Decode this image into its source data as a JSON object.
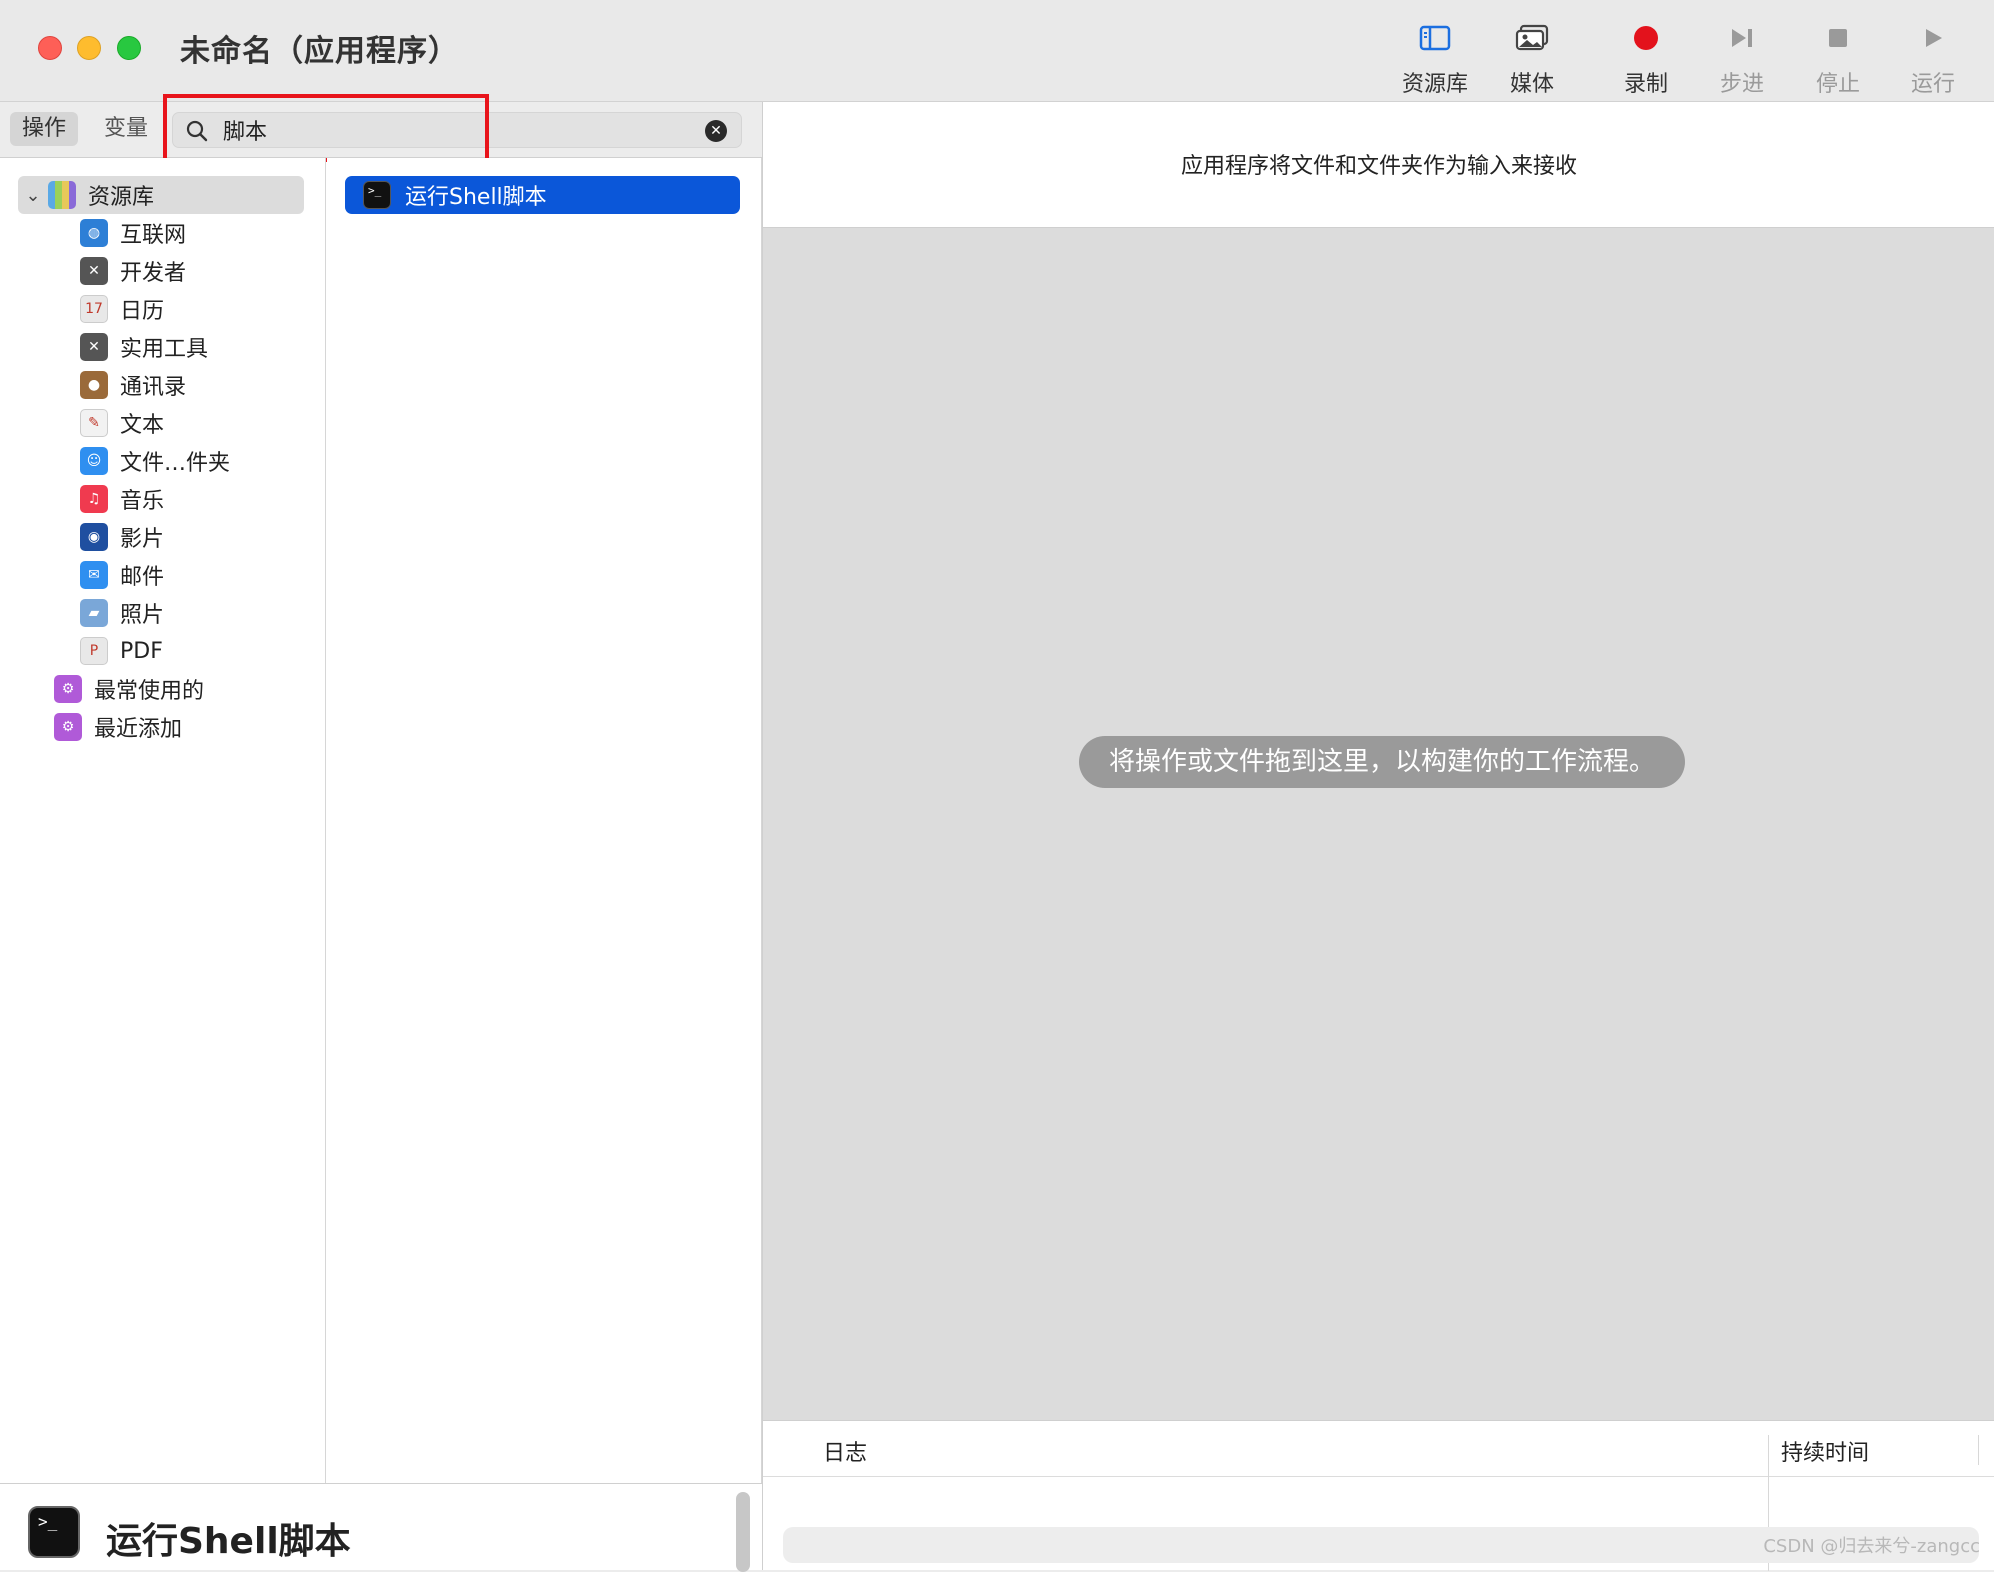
{
  "window": {
    "title": "未命名（应用程序）"
  },
  "toolbar": {
    "library": "资源库",
    "media": "媒体",
    "record": "录制",
    "step": "步进",
    "stop": "停止",
    "run": "运行"
  },
  "tabs": {
    "actions": "操作",
    "variables": "变量"
  },
  "search": {
    "value": "脚本"
  },
  "sidebar": {
    "root": "资源库",
    "items": [
      {
        "label": "互联网",
        "icon": "globe-icon",
        "color": "#2d7fd6"
      },
      {
        "label": "开发者",
        "icon": "tools-icon",
        "color": "#555555"
      },
      {
        "label": "日历",
        "icon": "calendar-icon",
        "color": "#e8e8e8"
      },
      {
        "label": "实用工具",
        "icon": "tools-icon",
        "color": "#555555"
      },
      {
        "label": "通讯录",
        "icon": "contacts-icon",
        "color": "#9a6a3a"
      },
      {
        "label": "文本",
        "icon": "text-icon",
        "color": "#f2f2f2"
      },
      {
        "label": "文件…件夹",
        "icon": "finder-icon",
        "color": "#2f8ff0"
      },
      {
        "label": "音乐",
        "icon": "music-icon",
        "color": "#f03a4f"
      },
      {
        "label": "影片",
        "icon": "quicktime-icon",
        "color": "#1f4fa0"
      },
      {
        "label": "邮件",
        "icon": "mail-icon",
        "color": "#2f8ff0"
      },
      {
        "label": "照片",
        "icon": "preview-icon",
        "color": "#7aa7d8"
      },
      {
        "label": "PDF",
        "icon": "pdf-icon",
        "color": "#e8e8e8"
      }
    ],
    "smart": [
      {
        "label": "最常使用的",
        "icon": "smart-folder-icon",
        "color": "#b05ad8"
      },
      {
        "label": "最近添加",
        "icon": "smart-folder-icon",
        "color": "#b05ad8"
      }
    ]
  },
  "actions": {
    "items": [
      "运行Shell脚本"
    ]
  },
  "detail": {
    "title": "运行Shell脚本"
  },
  "workflow": {
    "receives": "应用程序将文件和文件夹作为输入来接收",
    "hint": "将操作或文件拖到这里，以构建你的工作流程。"
  },
  "log": {
    "col_log": "日志",
    "col_duration": "持续时间"
  },
  "watermark": "CSDN @归去来兮-zangcc"
}
